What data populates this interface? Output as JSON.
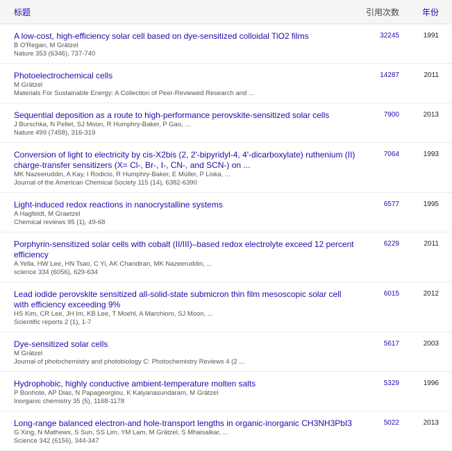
{
  "header": {
    "title_label": "标题",
    "cited_label": "引用次数",
    "year_label": "年份"
  },
  "articles": [
    {
      "title": "A low-cost, high-efficiency solar cell based on dye-sensitized colloidal TiO2 films",
      "authors": "B O'Regan, M Grätzel",
      "venue": "Nature 353 (6346), 737-740",
      "cites": "32245",
      "year": "1991"
    },
    {
      "title": "Photoelectrochemical cells",
      "authors": "M Grätzel",
      "venue": "Materials For Sustainable Energy: A Collection of Peer-Reviewed Research and ...",
      "cites": "14287",
      "year": "2011"
    },
    {
      "title": "Sequential deposition as a route to high-performance perovskite-sensitized solar cells",
      "authors": "J Burschka, N Pellet, SJ Moon, R Humphry-Baker, P Gao, ...",
      "venue": "Nature 499 (7458), 316-319",
      "cites": "7900",
      "year": "2013"
    },
    {
      "title": "Conversion of light to electricity by cis-X2bis (2, 2'-bipyridyl-4, 4'-dicarboxylate) ruthenium (II) charge-transfer sensitizers (X= Cl-, Br-, I-, CN-, and SCN-) on ...",
      "authors": "MK Nazeeruddin, A Kay, I Rodicio, R Humphry-Baker, E Müller, P Liska, ...",
      "venue": "Journal of the American Chemical Society 115 (14), 6382-6390",
      "cites": "7064",
      "year": "1993"
    },
    {
      "title": "Light-induced redox reactions in nanocrystalline systems",
      "authors": "A Hagfeldt, M Graetzel",
      "venue": "Chemical reviews 95 (1), 49-68",
      "cites": "6577",
      "year": "1995"
    },
    {
      "title": "Porphyrin-sensitized solar cells with cobalt (II/III)–based redox electrolyte exceed 12 percent efficiency",
      "authors": "A Yella, HW Lee, HN Tsao, C Yi, AK Chandiran, MK Nazeeruddin, ...",
      "venue": "science 334 (6056), 629-634",
      "cites": "6229",
      "year": "2011"
    },
    {
      "title": "Lead iodide perovskite sensitized all-solid-state submicron thin film mesoscopic solar cell with efficiency exceeding 9%",
      "authors": "HS Kim, CR Lee, JH Im, KB Lee, T Moehl, A Marchioro, SJ Moon, ...",
      "venue": "Scientific reports 2 (1), 1-7",
      "cites": "6015",
      "year": "2012"
    },
    {
      "title": "Dye-sensitized solar cells",
      "authors": "M Grätzel",
      "venue": "Journal of photochemistry and photobiology C: Photochemistry Reviews 4 (2 ...",
      "cites": "5617",
      "year": "2003"
    },
    {
      "title": "Hydrophobic, highly conductive ambient-temperature molten salts",
      "authors": "P Bonhote, AP Dias, N Papageorgiou, K Kalyanasundaram, M Grätzel",
      "venue": "Inorganic chemistry 35 (5), 1168-1178",
      "cites": "5329",
      "year": "1996"
    },
    {
      "title": "Long-range balanced electron-and hole-transport lengths in organic-inorganic CH3NH3PbI3",
      "authors": "G Xing, N Mathews, S Sun, SS Lim, YM Lam, M Grätzel, S Mhaisalkar, ...",
      "venue": "Science 342 (6156), 344-347",
      "cites": "5022",
      "year": "2013"
    }
  ]
}
